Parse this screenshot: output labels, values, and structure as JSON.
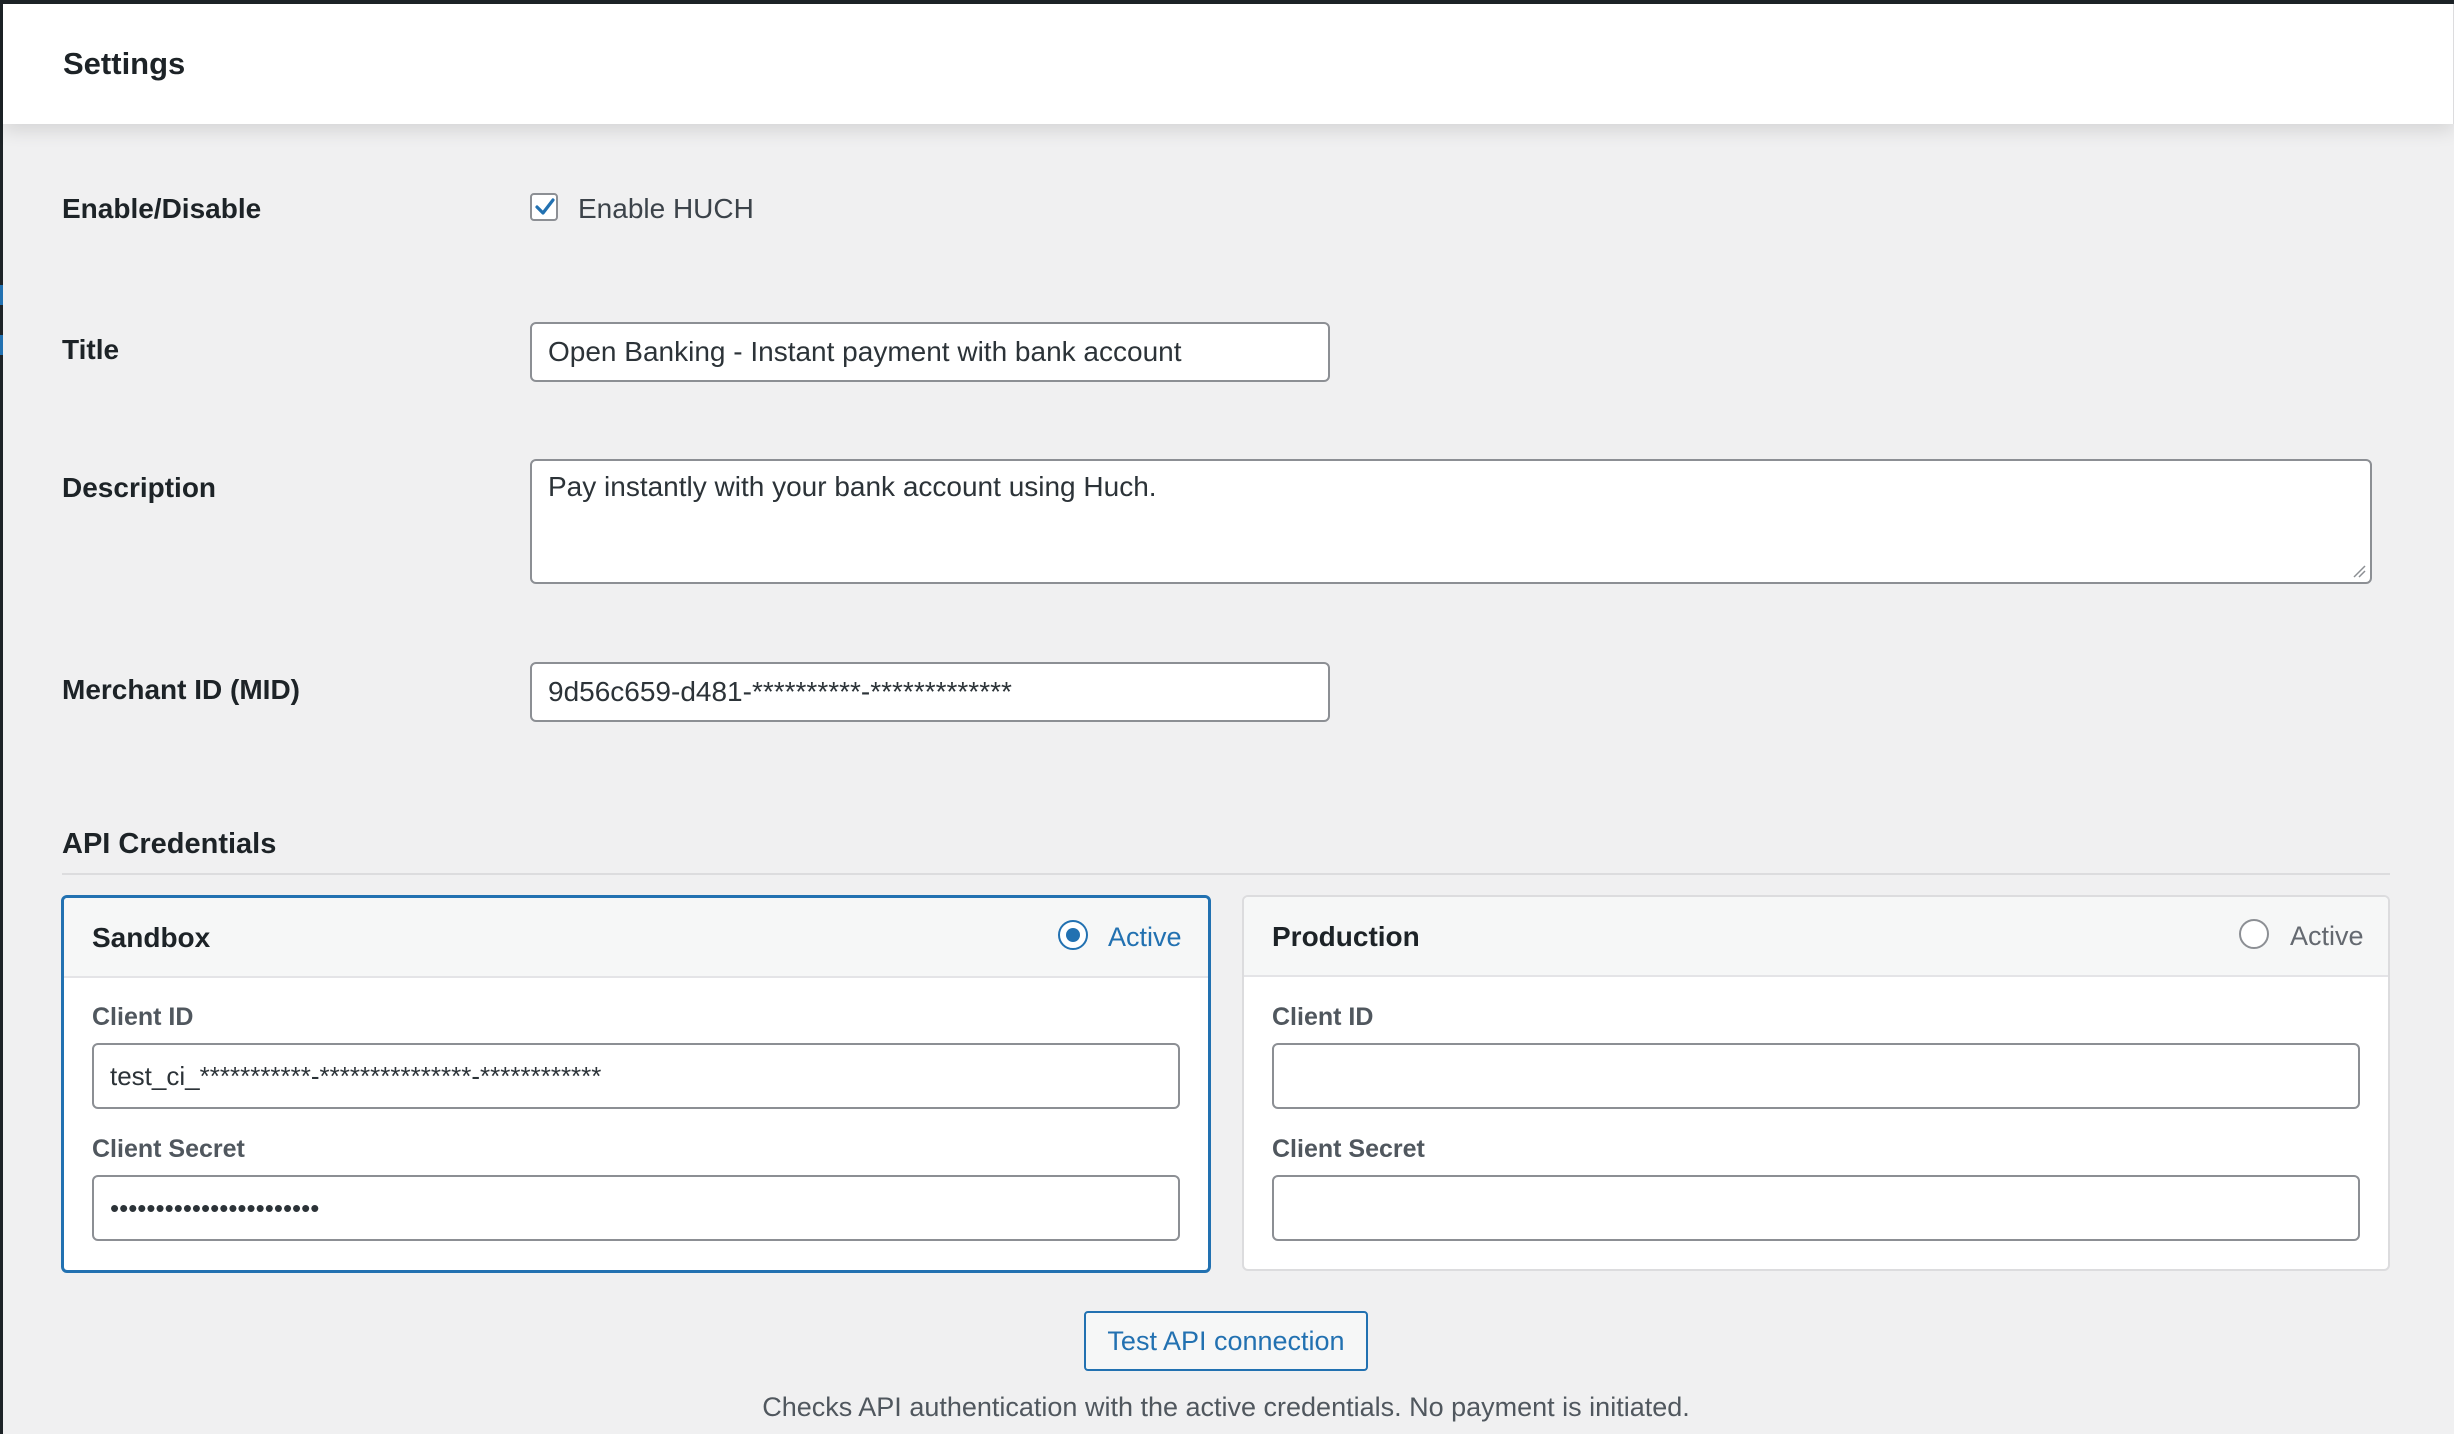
{
  "header": {
    "title": "Settings"
  },
  "fields": {
    "enable": {
      "label": "Enable/Disable",
      "checkbox_label": "Enable HUCH",
      "checked": true
    },
    "title": {
      "label": "Title",
      "value": "Open Banking - Instant payment with bank account"
    },
    "description": {
      "label": "Description",
      "value": "Pay instantly with your bank account using Huch."
    },
    "merchant_id": {
      "label": "Merchant ID (MID)",
      "value": "9d56c659-d481-**********-*************"
    }
  },
  "api": {
    "title": "API Credentials",
    "sandbox": {
      "title": "Sandbox",
      "active_label": "Active",
      "selected": true,
      "client_id_label": "Client ID",
      "client_id_value": "test_ci_***********-***************-************",
      "client_secret_label": "Client Secret",
      "client_secret_value": "•••••••••••••••••••••••"
    },
    "production": {
      "title": "Production",
      "active_label": "Active",
      "selected": false,
      "client_id_label": "Client ID",
      "client_id_value": "",
      "client_secret_label": "Client Secret",
      "client_secret_value": ""
    },
    "test_button": "Test API connection",
    "help": "Checks API authentication with the active credentials. No payment is initiated."
  },
  "colors": {
    "accent": "#2271b1",
    "background": "#f0f0f1",
    "text": "#1d2327"
  }
}
